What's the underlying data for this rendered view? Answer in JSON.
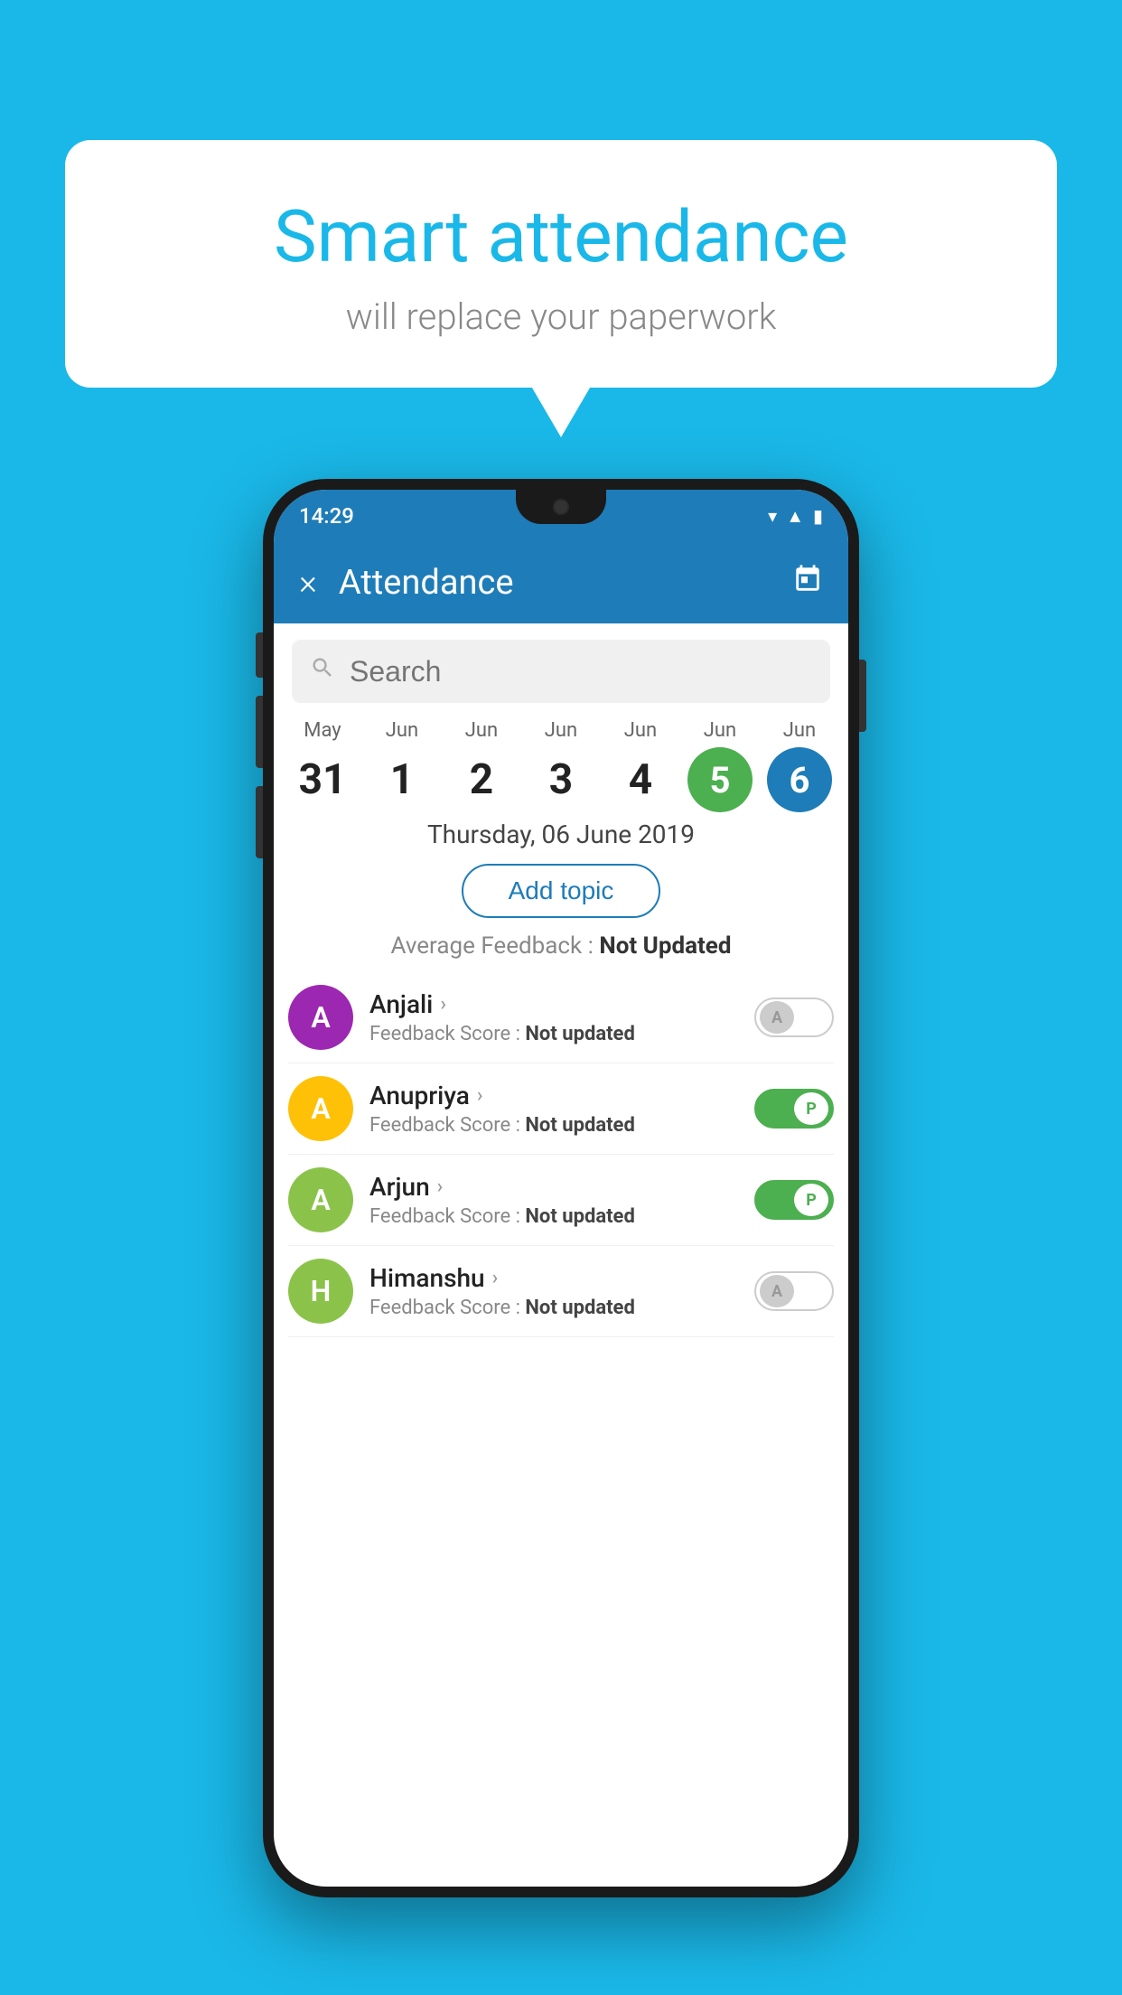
{
  "background_color": "#1ab8e8",
  "speech_bubble": {
    "title": "Smart attendance",
    "subtitle": "will replace your paperwork"
  },
  "status_bar": {
    "time": "14:29",
    "icons": [
      "wifi",
      "signal",
      "battery"
    ]
  },
  "app_bar": {
    "title": "Attendance",
    "close_label": "×",
    "calendar_icon": "📅"
  },
  "search": {
    "placeholder": "Search"
  },
  "date_strip": {
    "items": [
      {
        "month": "May",
        "day": "31",
        "state": "normal"
      },
      {
        "month": "Jun",
        "day": "1",
        "state": "normal"
      },
      {
        "month": "Jun",
        "day": "2",
        "state": "normal"
      },
      {
        "month": "Jun",
        "day": "3",
        "state": "normal"
      },
      {
        "month": "Jun",
        "day": "4",
        "state": "normal"
      },
      {
        "month": "Jun",
        "day": "5",
        "state": "today"
      },
      {
        "month": "Jun",
        "day": "6",
        "state": "selected"
      }
    ]
  },
  "selected_date": "Thursday, 06 June 2019",
  "add_topic_label": "Add topic",
  "avg_feedback_label": "Average Feedback :",
  "avg_feedback_value": "Not Updated",
  "students": [
    {
      "name": "Anjali",
      "avatar_letter": "A",
      "avatar_color": "#9c27b0",
      "feedback_label": "Feedback Score :",
      "feedback_value": "Not updated",
      "toggle": "off",
      "toggle_label": "A"
    },
    {
      "name": "Anupriya",
      "avatar_letter": "A",
      "avatar_color": "#ffc107",
      "feedback_label": "Feedback Score :",
      "feedback_value": "Not updated",
      "toggle": "on",
      "toggle_label": "P"
    },
    {
      "name": "Arjun",
      "avatar_letter": "A",
      "avatar_color": "#8bc34a",
      "feedback_label": "Feedback Score :",
      "feedback_value": "Not updated",
      "toggle": "on",
      "toggle_label": "P"
    },
    {
      "name": "Himanshu",
      "avatar_letter": "H",
      "avatar_color": "#8bc34a",
      "feedback_label": "Feedback Score :",
      "feedback_value": "Not updated",
      "toggle": "off",
      "toggle_label": "A"
    }
  ]
}
